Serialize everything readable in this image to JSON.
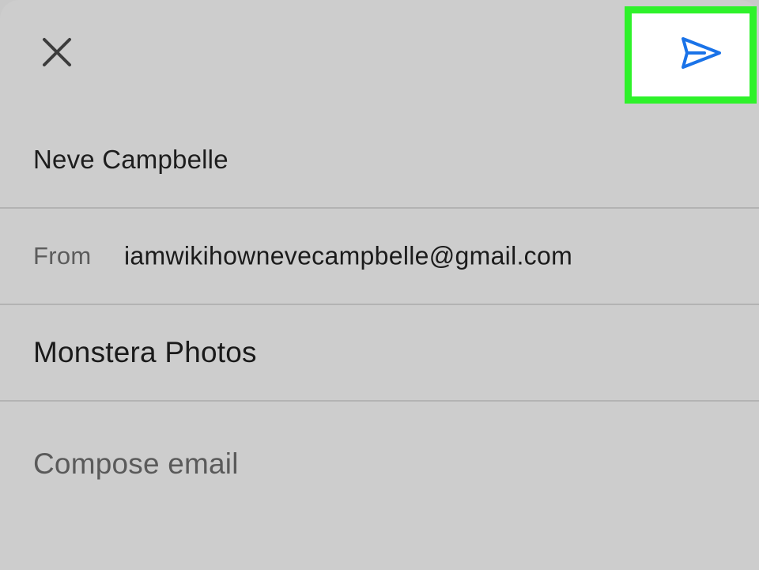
{
  "toolbar": {
    "close_icon": "close-icon",
    "send_icon": "send-icon",
    "send_icon_color": "#1a73e8",
    "highlight_color": "#2ef22a"
  },
  "compose": {
    "to": "Neve Campbelle",
    "from_label": "From",
    "from_value": "iamwikihownevecampbelle@gmail.com",
    "subject": "Monstera Photos",
    "body_placeholder": "Compose email"
  }
}
